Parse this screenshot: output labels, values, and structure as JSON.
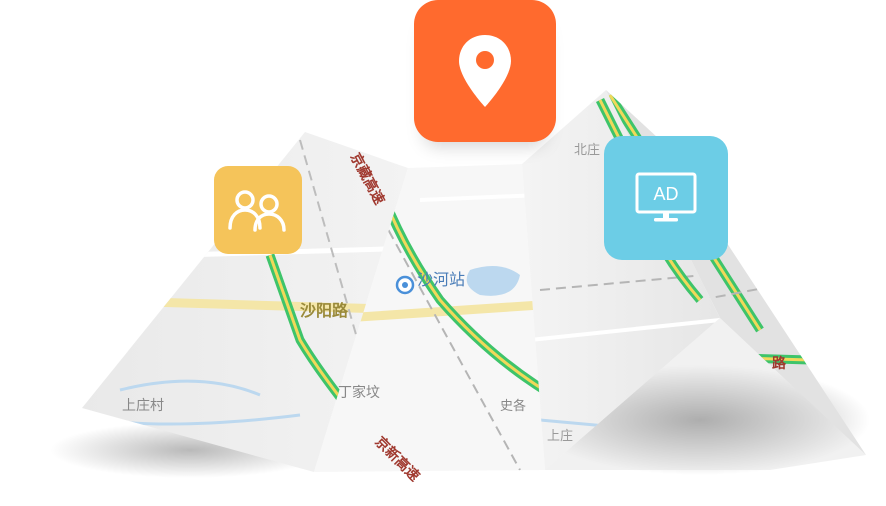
{
  "map": {
    "labels": {
      "station": "沙河站",
      "road_shayang": "沙阳路",
      "village_shangzhuang": "上庄村",
      "village_dingjia": "丁家坟",
      "village_beizhuang": "北庄",
      "road_top": "京藏高速",
      "road_bottom": "京新高速",
      "road_right": "路",
      "partial_shi": "史各",
      "partial_shang": "上庄"
    }
  },
  "tiles": {
    "location": {
      "icon": "location-pin-icon",
      "color": "#ff6a2e"
    },
    "users": {
      "icon": "users-icon",
      "color": "#f5c45a"
    },
    "ad": {
      "icon": "ad-monitor-icon",
      "color": "#6ccde6",
      "text": "AD"
    }
  }
}
